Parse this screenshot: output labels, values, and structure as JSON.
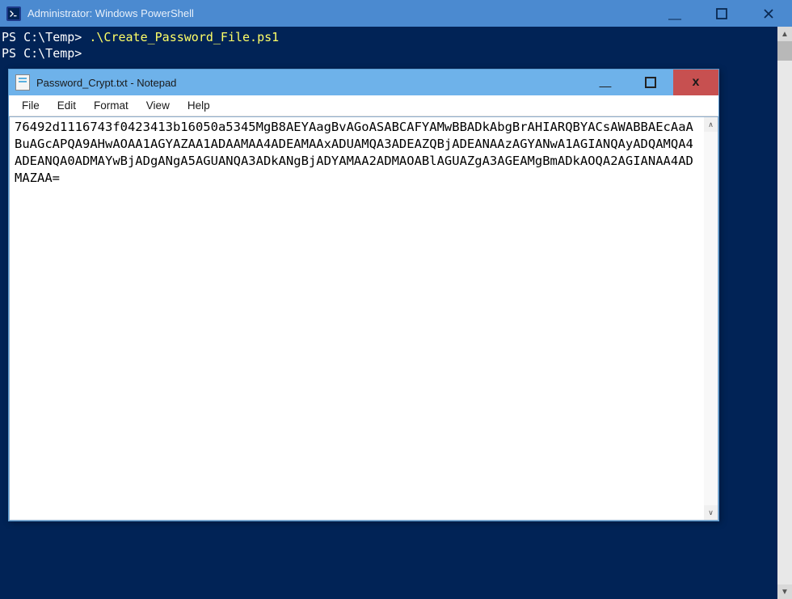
{
  "powershell": {
    "title": "Administrator: Windows PowerShell",
    "prompt1_prefix": "PS C:\\Temp> ",
    "command1": ".\\Create_Password_File.ps1",
    "prompt2_prefix": "PS C:\\Temp>"
  },
  "notepad": {
    "title": "Password_Crypt.txt - Notepad",
    "menu": {
      "file": "File",
      "edit": "Edit",
      "format": "Format",
      "view": "View",
      "help": "Help"
    },
    "content": "76492d1116743f0423413b16050a5345MgB8AEYAagBvAGoASABCAFYAMwBBADkAbgBrAHIARQBYACsAWABBAEcAaABuAGcAPQA9AHwAOAA1AGYAZAA1ADAAMAA4ADEAMAAxADUAMQA3ADEAZQBjADEANAAzAGYANwA1AGIANQAyADQAMQA4ADEANQA0ADMAYwBjADgANgA5AGUANQA3ADkANgBjADYAMAA2ADMAOABlAGUAZgA3AGEAMgBmADkAOQA2AGIANAA4ADMAZAA="
  }
}
